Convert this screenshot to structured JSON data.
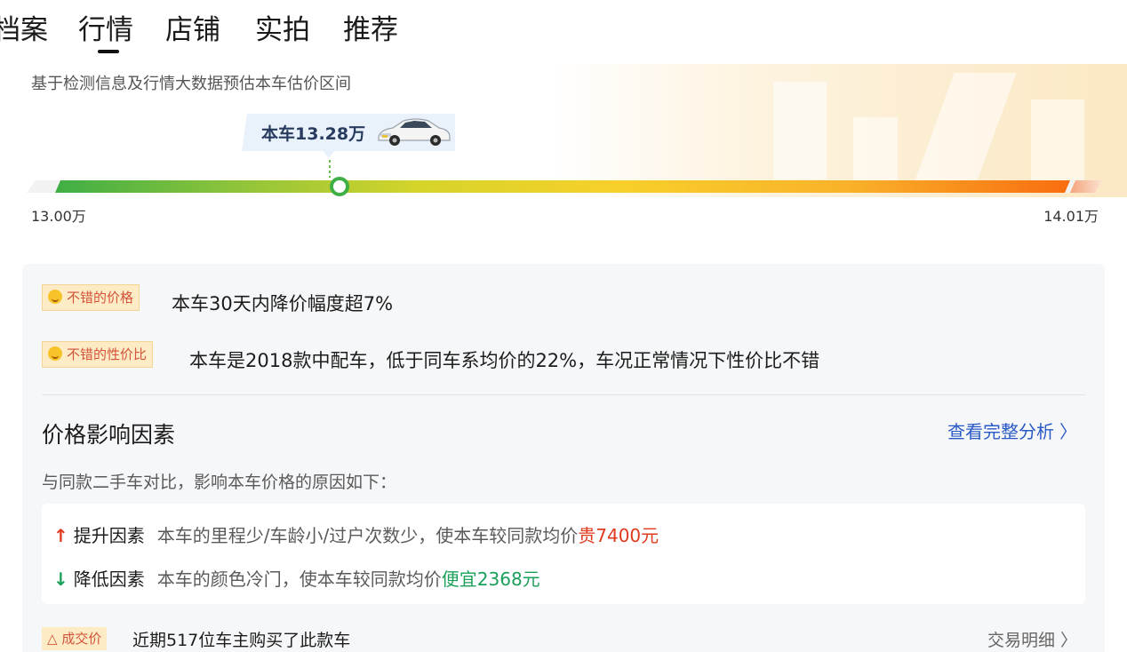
{
  "tabs": [
    {
      "label": "档案"
    },
    {
      "label": "行情"
    },
    {
      "label": "店铺"
    },
    {
      "label": "实拍"
    },
    {
      "label": "推荐"
    }
  ],
  "active_tab": "行情",
  "estimate": {
    "description": "基于检测信息及行情大数据预估本车估价区间",
    "this_car_price": "本车13.28万",
    "range_min": "13.00万",
    "range_max": "14.01万",
    "marker_fraction": 0.28
  },
  "tags": [
    {
      "badge": "不错的价格",
      "text": "本车30天内降价幅度超7%"
    },
    {
      "badge": "不错的性价比",
      "text": "本车是2018款中配车，低于同车系均价的22%，车况正常情况下性价比不错"
    }
  ],
  "factors": {
    "title": "价格影响因素",
    "link": "查看完整分析",
    "subtitle": "与同款二手车对比，影响本车价格的原因如下：",
    "rise": {
      "arrow": "↑",
      "label": "提升因素",
      "desc": "本车的里程少/车龄小/过户次数少，使本车较同款均价",
      "value": "贵7400元"
    },
    "fall": {
      "arrow": "↓",
      "label": "降低因素",
      "desc": "本车的颜色冷门，使本车较同款均价",
      "value": "便宜2368元"
    }
  },
  "deal": {
    "badge": "成交价",
    "text": "近期517位车主购买了此款车",
    "link": "交易明细 〉"
  },
  "colors": {
    "accent_blue": "#2a5ac5",
    "rise_red": "#e03a1e",
    "fall_green": "#1aa05a",
    "badge_bg": "#fcebc4"
  }
}
